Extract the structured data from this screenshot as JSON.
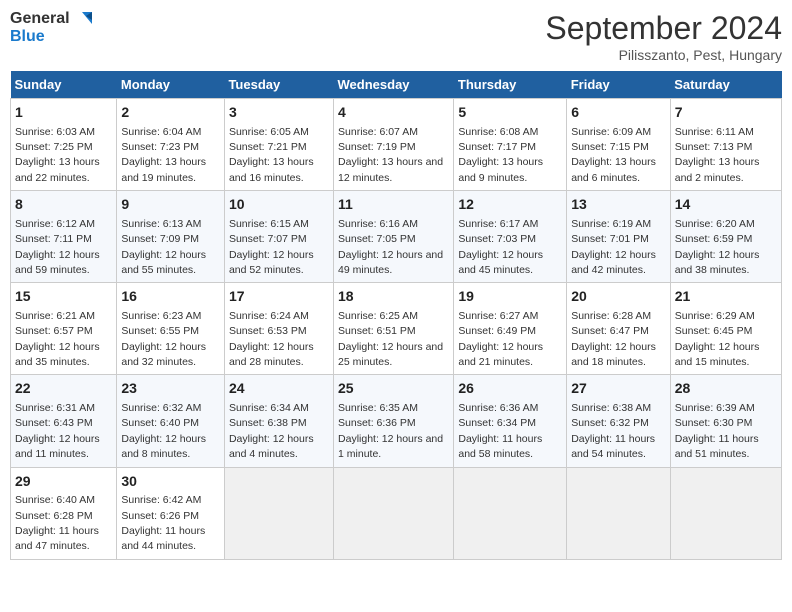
{
  "logo": {
    "line1": "General",
    "line2": "Blue"
  },
  "title": "September 2024",
  "subtitle": "Pilisszanto, Pest, Hungary",
  "days_header": [
    "Sunday",
    "Monday",
    "Tuesday",
    "Wednesday",
    "Thursday",
    "Friday",
    "Saturday"
  ],
  "weeks": [
    [
      {
        "day": "1",
        "sunrise": "6:03 AM",
        "sunset": "7:25 PM",
        "daylight": "13 hours and 22 minutes."
      },
      {
        "day": "2",
        "sunrise": "6:04 AM",
        "sunset": "7:23 PM",
        "daylight": "13 hours and 19 minutes."
      },
      {
        "day": "3",
        "sunrise": "6:05 AM",
        "sunset": "7:21 PM",
        "daylight": "13 hours and 16 minutes."
      },
      {
        "day": "4",
        "sunrise": "6:07 AM",
        "sunset": "7:19 PM",
        "daylight": "13 hours and 12 minutes."
      },
      {
        "day": "5",
        "sunrise": "6:08 AM",
        "sunset": "7:17 PM",
        "daylight": "13 hours and 9 minutes."
      },
      {
        "day": "6",
        "sunrise": "6:09 AM",
        "sunset": "7:15 PM",
        "daylight": "13 hours and 6 minutes."
      },
      {
        "day": "7",
        "sunrise": "6:11 AM",
        "sunset": "7:13 PM",
        "daylight": "13 hours and 2 minutes."
      }
    ],
    [
      {
        "day": "8",
        "sunrise": "6:12 AM",
        "sunset": "7:11 PM",
        "daylight": "12 hours and 59 minutes."
      },
      {
        "day": "9",
        "sunrise": "6:13 AM",
        "sunset": "7:09 PM",
        "daylight": "12 hours and 55 minutes."
      },
      {
        "day": "10",
        "sunrise": "6:15 AM",
        "sunset": "7:07 PM",
        "daylight": "12 hours and 52 minutes."
      },
      {
        "day": "11",
        "sunrise": "6:16 AM",
        "sunset": "7:05 PM",
        "daylight": "12 hours and 49 minutes."
      },
      {
        "day": "12",
        "sunrise": "6:17 AM",
        "sunset": "7:03 PM",
        "daylight": "12 hours and 45 minutes."
      },
      {
        "day": "13",
        "sunrise": "6:19 AM",
        "sunset": "7:01 PM",
        "daylight": "12 hours and 42 minutes."
      },
      {
        "day": "14",
        "sunrise": "6:20 AM",
        "sunset": "6:59 PM",
        "daylight": "12 hours and 38 minutes."
      }
    ],
    [
      {
        "day": "15",
        "sunrise": "6:21 AM",
        "sunset": "6:57 PM",
        "daylight": "12 hours and 35 minutes."
      },
      {
        "day": "16",
        "sunrise": "6:23 AM",
        "sunset": "6:55 PM",
        "daylight": "12 hours and 32 minutes."
      },
      {
        "day": "17",
        "sunrise": "6:24 AM",
        "sunset": "6:53 PM",
        "daylight": "12 hours and 28 minutes."
      },
      {
        "day": "18",
        "sunrise": "6:25 AM",
        "sunset": "6:51 PM",
        "daylight": "12 hours and 25 minutes."
      },
      {
        "day": "19",
        "sunrise": "6:27 AM",
        "sunset": "6:49 PM",
        "daylight": "12 hours and 21 minutes."
      },
      {
        "day": "20",
        "sunrise": "6:28 AM",
        "sunset": "6:47 PM",
        "daylight": "12 hours and 18 minutes."
      },
      {
        "day": "21",
        "sunrise": "6:29 AM",
        "sunset": "6:45 PM",
        "daylight": "12 hours and 15 minutes."
      }
    ],
    [
      {
        "day": "22",
        "sunrise": "6:31 AM",
        "sunset": "6:43 PM",
        "daylight": "12 hours and 11 minutes."
      },
      {
        "day": "23",
        "sunrise": "6:32 AM",
        "sunset": "6:40 PM",
        "daylight": "12 hours and 8 minutes."
      },
      {
        "day": "24",
        "sunrise": "6:34 AM",
        "sunset": "6:38 PM",
        "daylight": "12 hours and 4 minutes."
      },
      {
        "day": "25",
        "sunrise": "6:35 AM",
        "sunset": "6:36 PM",
        "daylight": "12 hours and 1 minute."
      },
      {
        "day": "26",
        "sunrise": "6:36 AM",
        "sunset": "6:34 PM",
        "daylight": "11 hours and 58 minutes."
      },
      {
        "day": "27",
        "sunrise": "6:38 AM",
        "sunset": "6:32 PM",
        "daylight": "11 hours and 54 minutes."
      },
      {
        "day": "28",
        "sunrise": "6:39 AM",
        "sunset": "6:30 PM",
        "daylight": "11 hours and 51 minutes."
      }
    ],
    [
      {
        "day": "29",
        "sunrise": "6:40 AM",
        "sunset": "6:28 PM",
        "daylight": "11 hours and 47 minutes."
      },
      {
        "day": "30",
        "sunrise": "6:42 AM",
        "sunset": "6:26 PM",
        "daylight": "11 hours and 44 minutes."
      },
      null,
      null,
      null,
      null,
      null
    ]
  ]
}
